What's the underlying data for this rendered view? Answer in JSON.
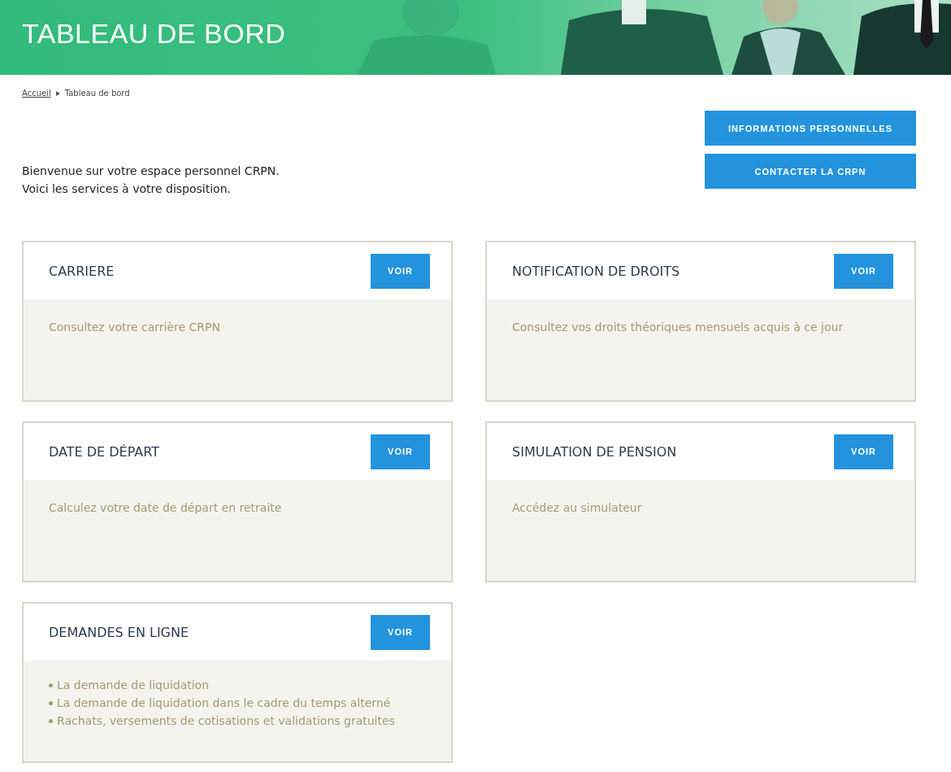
{
  "header": {
    "title": "TABLEAU DE BORD"
  },
  "breadcrumb": [
    {
      "label": "Accueil",
      "kind": "link"
    },
    {
      "label": "Tableau de bord",
      "kind": "current"
    }
  ],
  "actions": [
    "INFORMATIONS PERSONNELLES",
    "CONTACTER LA CRPN"
  ],
  "welcome": [
    "Bienvenue sur votre espace personnel CRPN.",
    "Voici les services à votre disposition."
  ],
  "cards": [
    {
      "title": "CARRIERE",
      "button": "VOIR",
      "kind": "text",
      "text": "Consultez votre carrière CRPN"
    },
    {
      "title": "NOTIFICATION DE DROITS",
      "button": "VOIR",
      "kind": "text",
      "text": "Consultez vos droits théoriques mensuels acquis à ce jour"
    },
    {
      "title": "DATE DE DÉPART",
      "button": "VOIR",
      "kind": "text",
      "text": "Calculez votre date de départ en retraite"
    },
    {
      "title": "SIMULATION DE PENSION",
      "button": "VOIR",
      "kind": "text",
      "text": "Accédez au simulateur"
    },
    {
      "title": "DEMANDES EN LIGNE",
      "button": "VOIR",
      "kind": "list",
      "items": [
        "La demande de liquidation",
        "La demande de liquidation dans le cadre du temps alterné",
        "Rachats, versements de cotisations et validations gratuites"
      ]
    }
  ]
}
